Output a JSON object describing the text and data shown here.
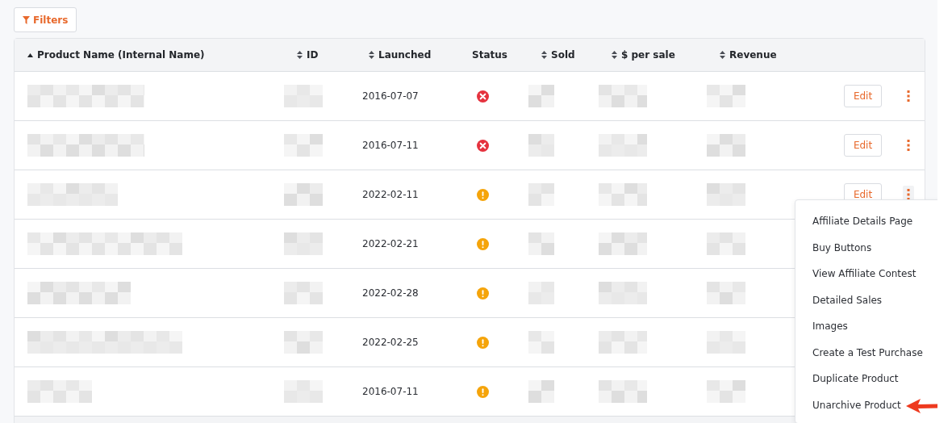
{
  "filters_button": {
    "label": "Filters"
  },
  "table": {
    "columns": [
      {
        "label": "Product Name (Internal Name)",
        "sortable": true,
        "sorted": true
      },
      {
        "label": "ID",
        "sortable": true,
        "sorted": false
      },
      {
        "label": "Launched",
        "sortable": true,
        "sorted": false
      },
      {
        "label": "Status",
        "sortable": false,
        "sorted": false
      },
      {
        "label": "Sold",
        "sortable": true,
        "sorted": false
      },
      {
        "label": "$ per sale",
        "sortable": true,
        "sorted": false
      },
      {
        "label": "Revenue",
        "sortable": true,
        "sorted": false
      }
    ],
    "rows": [
      {
        "launched": "2016-07-07",
        "color": "#e5323e",
        "edit": "Edit",
        "menu_open": false
      },
      {
        "launched": "2016-07-11",
        "color": "#e5323e",
        "edit": "Edit",
        "menu_open": false
      },
      {
        "launched": "2022-02-11",
        "color": "#f5a40a",
        "edit": "Edit",
        "menu_open": true
      },
      {
        "launched": "2022-02-21",
        "color": "#f5a40a"
      },
      {
        "launched": "2022-02-28",
        "color": "#f5a40a"
      },
      {
        "launched": "2022-02-25",
        "color": "#f5a40a"
      },
      {
        "launched": "2016-07-11",
        "color": "#f5a40a"
      }
    ]
  },
  "menu": {
    "items": [
      {
        "label": "Affiliate Details Page",
        "pointed": false
      },
      {
        "label": "Buy Buttons",
        "pointed": false
      },
      {
        "label": "View Affiliate Contest",
        "pointed": false
      },
      {
        "label": "Detailed Sales",
        "pointed": false
      },
      {
        "label": "Images",
        "pointed": false
      },
      {
        "label": "Create a Test Purchase",
        "pointed": false
      },
      {
        "label": "Duplicate Product",
        "pointed": false
      },
      {
        "label": "Unarchive Product",
        "pointed": true
      }
    ]
  }
}
